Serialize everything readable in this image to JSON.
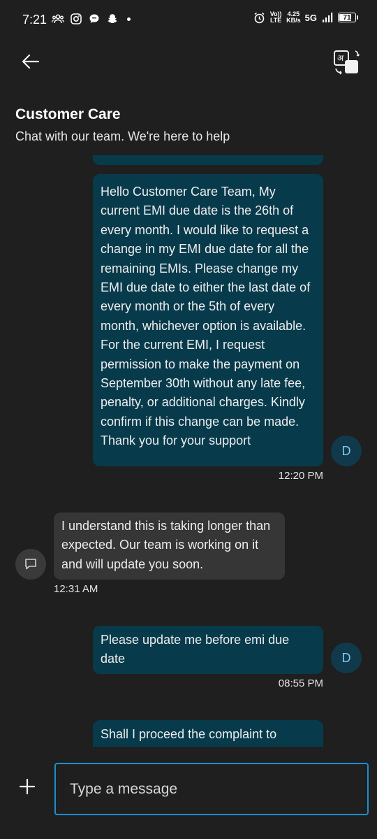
{
  "status_bar": {
    "time": "7:21",
    "network_label": "Vo)) LTE",
    "speed_value": "4.25",
    "speed_unit": "KB/s",
    "network_type": "5G",
    "battery_level": "71",
    "icons": [
      "group-icon",
      "instagram-icon",
      "chat-bubble-icon",
      "snapchat-icon",
      "dot-icon",
      "alarm-icon",
      "signal-icon",
      "battery-icon"
    ]
  },
  "header": {
    "title": "Customer Care",
    "subtitle": "Chat with our team. We're here to help",
    "icons": [
      "back-arrow-icon",
      "translate-icon"
    ]
  },
  "messages": [
    {
      "direction": "outgoing",
      "avatar": "D",
      "text": "Hello Customer Care Team, My current EMI due date is the 26th of every month. I would like to request a change in my EMI due date for all the remaining EMIs. Please change my EMI due date to either the last date of every month or the 5th of every month, whichever option is available. For the current EMI, I request permission to make the payment on September 30th without any late fee, penalty, or additional charges. Kindly confirm if this change can be made. Thank you for your support",
      "time": "12:20 PM"
    },
    {
      "direction": "incoming",
      "avatar_icon": "chat-icon",
      "text": "I understand this is taking longer than expected. Our team is working on it and will update you soon.",
      "time": "12:31 AM"
    },
    {
      "direction": "outgoing",
      "avatar": "D",
      "text": "Please update me before emi due date",
      "time": "08:55 PM"
    },
    {
      "direction": "outgoing",
      "text": "Shall I proceed the complaint to"
    }
  ],
  "composer": {
    "placeholder": "Type a message",
    "icons": [
      "plus-icon"
    ]
  },
  "colors": {
    "background": "#1f1f1f",
    "outgoing_bubble": "#073b4c",
    "incoming_bubble": "#363636",
    "input_border": "#1a8fd0",
    "avatar_text": "#7cc8ee"
  }
}
